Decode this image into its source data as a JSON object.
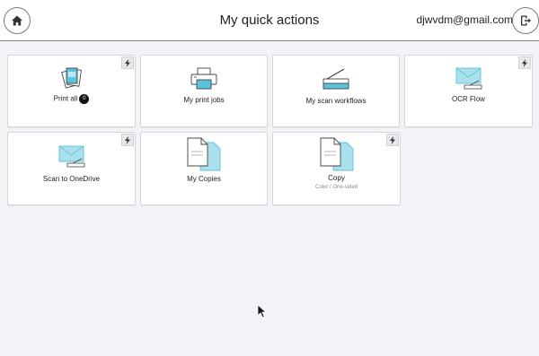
{
  "header": {
    "title": "My quick actions",
    "email": "djwvdm@gmail.com"
  },
  "tiles": [
    {
      "label": "Print all",
      "badge": "0",
      "icon": "print-all-icon",
      "quick": true
    },
    {
      "label": "My print jobs",
      "icon": "printer-icon",
      "quick": false
    },
    {
      "label": "My scan workflows",
      "icon": "scanner-icon",
      "quick": false
    },
    {
      "label": "OCR Flow",
      "icon": "envelope-scan-icon",
      "quick": true
    },
    {
      "label": "Scan to OneDrive",
      "icon": "envelope-scan-icon",
      "quick": true
    },
    {
      "label": "My Copies",
      "icon": "copies-icon",
      "quick": false
    },
    {
      "label": "Copy",
      "sublabel": "Color / One-sided",
      "icon": "copies-icon",
      "quick": true
    }
  ],
  "colors": {
    "accent": "#5bc4dc",
    "background": "#f1f3f6"
  }
}
